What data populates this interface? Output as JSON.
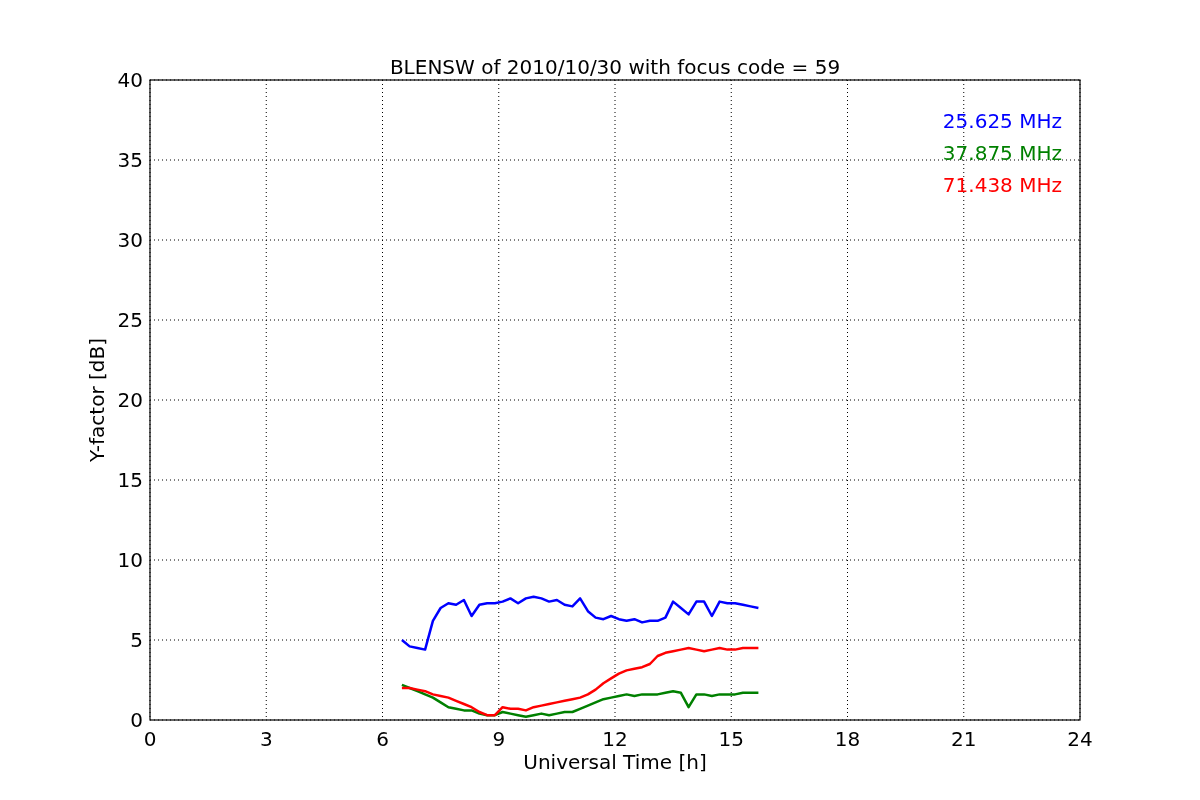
{
  "chart_data": {
    "type": "line",
    "title": "BLENSW of 2010/10/30 with focus code = 59",
    "xlabel": "Universal Time [h]",
    "ylabel": "Y-factor [dB]",
    "x": [
      6.5,
      6.7,
      6.9,
      7.1,
      7.3,
      7.5,
      7.7,
      7.9,
      8.1,
      8.3,
      8.5,
      8.7,
      8.9,
      9.1,
      9.3,
      9.5,
      9.7,
      9.9,
      10.1,
      10.3,
      10.5,
      10.7,
      10.9,
      11.1,
      11.3,
      11.5,
      11.7,
      11.9,
      12.1,
      12.3,
      12.5,
      12.7,
      12.9,
      13.1,
      13.3,
      13.5,
      13.7,
      13.9,
      14.1,
      14.3,
      14.5,
      14.7,
      14.9,
      15.1,
      15.3,
      15.5,
      15.7
    ],
    "series": [
      {
        "name": "25.625 MHz",
        "color": "#0000ff",
        "values": [
          5.0,
          4.6,
          4.5,
          4.4,
          6.2,
          7.0,
          7.3,
          7.2,
          7.5,
          6.5,
          7.2,
          7.3,
          7.3,
          7.4,
          7.6,
          7.3,
          7.6,
          7.7,
          7.6,
          7.4,
          7.5,
          7.2,
          7.1,
          7.6,
          6.8,
          6.4,
          6.3,
          6.5,
          6.3,
          6.2,
          6.3,
          6.1,
          6.2,
          6.2,
          6.4,
          7.4,
          7.0,
          6.6,
          7.4,
          7.4,
          6.5,
          7.4,
          7.3,
          7.3,
          7.2,
          7.1,
          7.0
        ]
      },
      {
        "name": "37.875 MHz",
        "color": "#008000",
        "values": [
          2.2,
          2.0,
          1.8,
          1.6,
          1.4,
          1.1,
          0.8,
          0.7,
          0.6,
          0.6,
          0.4,
          0.3,
          0.3,
          0.5,
          0.4,
          0.3,
          0.2,
          0.3,
          0.4,
          0.3,
          0.4,
          0.5,
          0.5,
          0.7,
          0.9,
          1.1,
          1.3,
          1.4,
          1.5,
          1.6,
          1.5,
          1.6,
          1.6,
          1.6,
          1.7,
          1.8,
          1.7,
          0.8,
          1.6,
          1.6,
          1.5,
          1.6,
          1.6,
          1.6,
          1.7,
          1.7,
          1.7
        ]
      },
      {
        "name": "71.438 MHz",
        "color": "#ff0000",
        "values": [
          2.0,
          2.0,
          1.9,
          1.8,
          1.6,
          1.5,
          1.4,
          1.2,
          1.0,
          0.8,
          0.5,
          0.3,
          0.3,
          0.8,
          0.7,
          0.7,
          0.6,
          0.8,
          0.9,
          1.0,
          1.1,
          1.2,
          1.3,
          1.4,
          1.6,
          1.9,
          2.3,
          2.6,
          2.9,
          3.1,
          3.2,
          3.3,
          3.5,
          4.0,
          4.2,
          4.3,
          4.4,
          4.5,
          4.4,
          4.3,
          4.4,
          4.5,
          4.4,
          4.4,
          4.5,
          4.5,
          4.5
        ]
      }
    ],
    "grid": true,
    "xlim": [
      0,
      24
    ],
    "ylim": [
      0,
      40
    ],
    "xticks": [
      0,
      3,
      6,
      9,
      12,
      15,
      18,
      21,
      24
    ],
    "yticks": [
      0,
      5,
      10,
      15,
      20,
      25,
      30,
      35,
      40
    ]
  }
}
